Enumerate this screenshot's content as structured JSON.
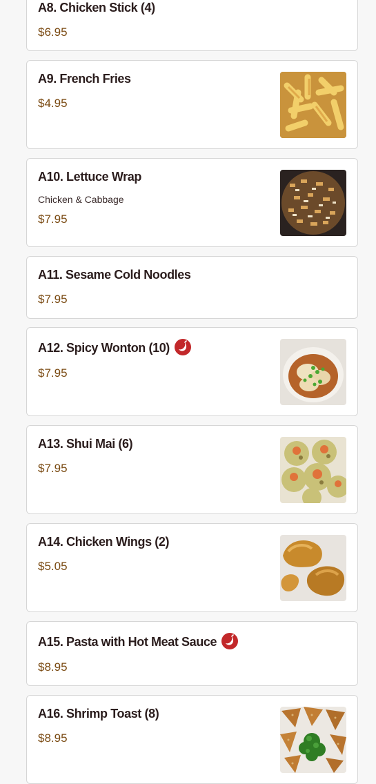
{
  "colors": {
    "name": "#2b1d1d",
    "price": "#7a4a12",
    "spicy": "#c2282a"
  },
  "menu_items": [
    {
      "name": "A8. Chicken Stick (4)",
      "price": "$6.95"
    },
    {
      "name": "A9. French Fries",
      "price": "$4.95",
      "image": "french-fries"
    },
    {
      "name": "A10. Lettuce Wrap",
      "description": "Chicken & Cabbage",
      "price": "$7.95",
      "image": "lettuce-wrap"
    },
    {
      "name": "A11. Sesame Cold Noodles",
      "price": "$7.95"
    },
    {
      "name": "A12. Spicy Wonton (10)",
      "price": "$7.95",
      "spicy": true,
      "image": "spicy-wonton"
    },
    {
      "name": "A13. Shui Mai (6)",
      "price": "$7.95",
      "image": "shui-mai"
    },
    {
      "name": "A14. Chicken Wings (2)",
      "price": "$5.05",
      "image": "chicken-wings"
    },
    {
      "name": "A15. Pasta with Hot Meat Sauce",
      "price": "$8.95",
      "spicy": true
    },
    {
      "name": "A16. Shrimp Toast (8)",
      "price": "$8.95",
      "image": "shrimp-toast"
    }
  ]
}
